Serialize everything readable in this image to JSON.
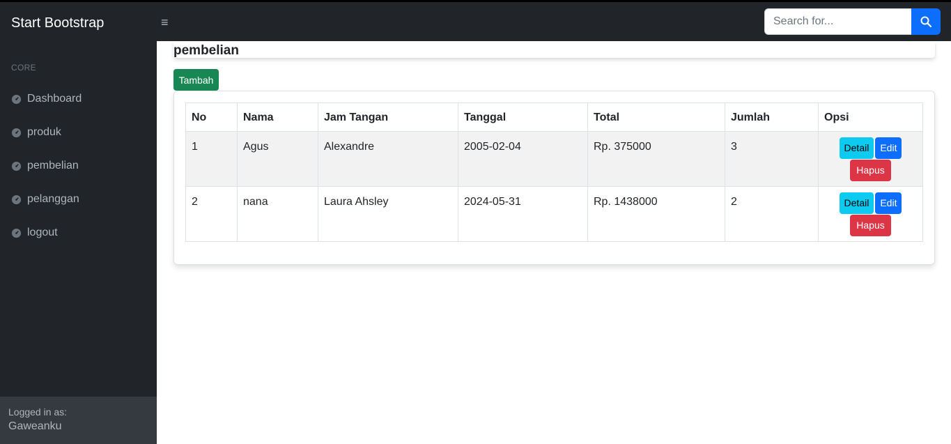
{
  "nav": {
    "brand": "Start Bootstrap",
    "toggle_icon": "≡",
    "search_placeholder": "Search for..."
  },
  "sidebar": {
    "heading": "CORE",
    "items": [
      {
        "label": "Dashboard"
      },
      {
        "label": "produk"
      },
      {
        "label": "pembelian"
      },
      {
        "label": "pelanggan"
      },
      {
        "label": "logout"
      }
    ],
    "footer": {
      "logged_in_label": "Logged in as:",
      "username": "Gaweanku"
    }
  },
  "main": {
    "title": "pembelian",
    "add_button": "Tambah",
    "table": {
      "headers": [
        "No",
        "Nama",
        "Jam Tangan",
        "Tanggal",
        "Total",
        "Jumlah",
        "Opsi"
      ],
      "rows": [
        {
          "no": "1",
          "nama": "Agus",
          "jam": "Alexandre",
          "tanggal": "2005-02-04",
          "total": "Rp. 375000",
          "jumlah": "3"
        },
        {
          "no": "2",
          "nama": "nana",
          "jam": "Laura Ahsley",
          "tanggal": "2024-05-31",
          "total": "Rp. 1438000",
          "jumlah": "2"
        }
      ],
      "actions": {
        "detail": "Detail",
        "edit": "Edit",
        "hapus": "Hapus"
      }
    }
  },
  "colors": {
    "nav_bg": "#212529",
    "primary": "#0d6efd",
    "success": "#198754",
    "info": "#0dcaf0",
    "danger": "#dc3545"
  }
}
